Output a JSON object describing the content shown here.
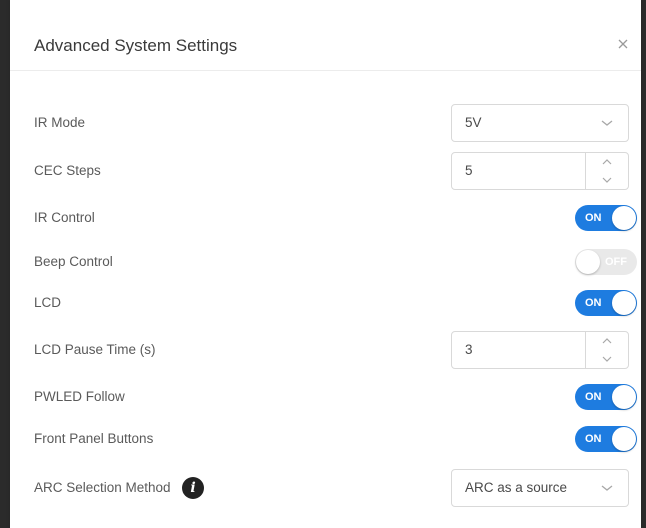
{
  "dialog": {
    "title": "Advanced System Settings",
    "close_icon": "close-icon"
  },
  "settings": {
    "ir_mode": {
      "label": "IR Mode",
      "value": "5V"
    },
    "cec_steps": {
      "label": "CEC Steps",
      "value": "5"
    },
    "ir_control": {
      "label": "IR Control",
      "state": "ON"
    },
    "beep_control": {
      "label": "Beep Control",
      "state": "OFF"
    },
    "lcd": {
      "label": "LCD",
      "state": "ON"
    },
    "lcd_pause_time": {
      "label": "LCD Pause Time (s)",
      "value": "3"
    },
    "pwled_follow": {
      "label": "PWLED Follow",
      "state": "ON"
    },
    "front_panel_buttons": {
      "label": "Front Panel Buttons",
      "state": "ON"
    },
    "arc_selection_method": {
      "label": "ARC Selection Method",
      "value": "ARC as a source",
      "info_icon": "info-icon"
    }
  },
  "colors": {
    "toggle_on": "#1e7ce0",
    "toggle_off": "#e9e9e9"
  }
}
